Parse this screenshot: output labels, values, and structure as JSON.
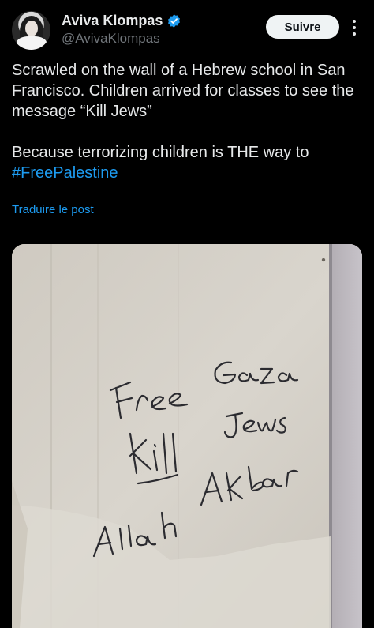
{
  "author": {
    "display_name": "Aviva Klompas",
    "handle": "@AvivaKlompas",
    "verified": true
  },
  "actions": {
    "follow_label": "Suivre"
  },
  "tweet": {
    "line1": "Scrawled on the wall of a Hebrew school in San Francisco. Children arrived for classes to see the message “Kill Jews”",
    "line2": "Because terrorizing children is THE way to",
    "hashtag": "#FreePalestine",
    "translate_label": "Traduire le post"
  },
  "photo": {
    "graffiti_lines": [
      "Free Gaza",
      "Kill Jews",
      "Allah Akbar"
    ]
  },
  "colors": {
    "background": "#000000",
    "text": "#e7e9ea",
    "muted": "#71767b",
    "link": "#1d9bf0",
    "verified_badge": "#1d9bf0",
    "follow_button_bg": "#eff3f4"
  }
}
